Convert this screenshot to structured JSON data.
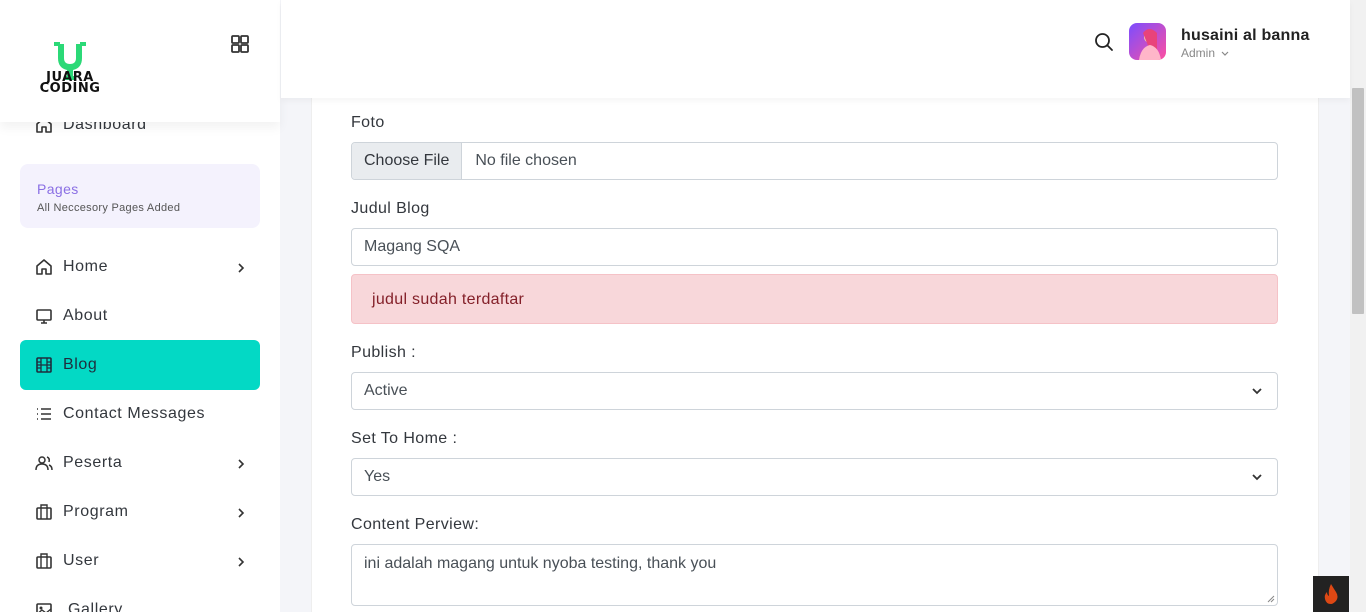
{
  "brand": {
    "logo_text_line1": "JUARA",
    "logo_text_line2": "CODING",
    "accent": "#03d9c5"
  },
  "header": {
    "user_name": "husaini al banna",
    "user_role": "Admin"
  },
  "sidebar": {
    "pages_card": {
      "title": "Pages",
      "subtitle": "All Neccesory Pages Added"
    },
    "items": [
      {
        "label": "Dashboard",
        "icon": "home-icon"
      },
      {
        "label": "Home",
        "icon": "home-icon",
        "has_children": true
      },
      {
        "label": "About",
        "icon": "monitor-icon"
      },
      {
        "label": "Blog",
        "icon": "film-icon",
        "active": true
      },
      {
        "label": "Contact Messages",
        "icon": "list-icon"
      },
      {
        "label": "Peserta",
        "icon": "users-icon",
        "has_children": true
      },
      {
        "label": "Program",
        "icon": "briefcase-icon",
        "has_children": true
      },
      {
        "label": "User",
        "icon": "briefcase-icon",
        "has_children": true
      },
      {
        "label": "Gallery",
        "icon": "image-icon"
      }
    ]
  },
  "form": {
    "foto_label": "Foto",
    "file_button": "Choose File",
    "file_status": "No file chosen",
    "judul_label": "Judul Blog",
    "judul_value": "Magang SQA",
    "error_message": "judul sudah terdaftar",
    "publish_label": "Publish :",
    "publish_value": "Active",
    "set_home_label": "Set To Home :",
    "set_home_value": "Yes",
    "content_label": "Content Perview:",
    "content_value": "ini adalah magang untuk nyoba testing, thank you"
  }
}
